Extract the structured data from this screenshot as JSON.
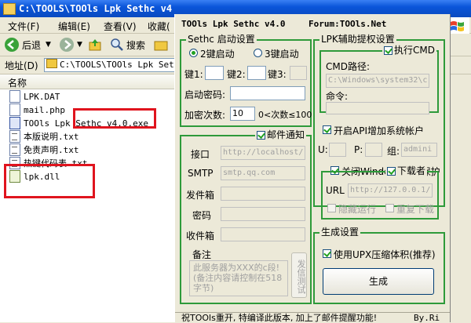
{
  "explorer": {
    "title": "C:\\TOOLS\\TOOls Lpk Sethc v4",
    "menu": [
      "文件(F)",
      "编辑(E)",
      "查看(V)",
      "收藏("
    ],
    "toolbar": {
      "back_label": "后退",
      "search_label": "搜索"
    },
    "address": {
      "label": "地址(D)",
      "value": "C:\\TOOLS\\TOOls Lpk Sethc"
    },
    "column_name": "名称",
    "files": [
      {
        "name": "LPK.DAT",
        "icon": "document-icon"
      },
      {
        "name": "mail.php",
        "icon": "document-icon"
      },
      {
        "name": "TOOls Lpk Sethc v4.0.exe",
        "icon": "exe-icon"
      },
      {
        "name": "本版说明.txt",
        "icon": "text-file-icon"
      },
      {
        "name": "免责声明.txt",
        "icon": "text-file-icon"
      },
      {
        "name": "热键代码表.txt",
        "icon": "text-file-icon"
      },
      {
        "name": "lpk.dll",
        "icon": "dll-icon"
      }
    ]
  },
  "tool": {
    "title": "TOOls Lpk Sethc v4.0",
    "forum": "Forum:TOOls.Net",
    "sethc": {
      "group_label": "Sethc 启动设置",
      "radio_2key": "2键启动",
      "radio_3key": "3键启动",
      "key1_label": "键1:",
      "key2_label": "键2:",
      "key3_label": "键3:",
      "key1_value": "",
      "key2_value": "",
      "key3_value": "",
      "password_label": "启动密码:",
      "password_value": "",
      "attempts_label": "加密次数:",
      "attempts_value": "10",
      "attempts_hint": "0<次数≤100"
    },
    "lpk": {
      "group_label": "LPK辅助提权设置",
      "exec_cmd_label": "执行CMD",
      "cmd_path_label": "CMD路径:",
      "cmd_path_value": "C:\\Windows\\system32\\c",
      "command_label": "命令:",
      "command_value": ""
    },
    "api_account": {
      "label": "开启API增加系统帐户",
      "u_label": "U:",
      "p_label": "P:",
      "group_label": "组:",
      "group_value": "admini"
    },
    "close_wfp_label": "关闭Windows文件保护",
    "mail": {
      "group_label": "邮件通知",
      "port_label": "接口",
      "port_value": "http://localhost/",
      "smtp_label": "SMTP",
      "smtp_value": "smtp.qq.com",
      "sender_label": "发件箱",
      "password_label": "密码",
      "receiver_label": "收件箱",
      "remark_label": "备注",
      "remark_value": "此服务器为XXX的c段!(备注内容请控制在518字节)",
      "test_button": "发信测试"
    },
    "downloader": {
      "group_label": "下载者",
      "url_label": "URL",
      "url_value": "http://127.0.0.1/",
      "hidden_run": "隐藏运行",
      "repeat_download": "重复下载"
    },
    "generate": {
      "group_label": "生成设置",
      "upx_label": "使用UPX压缩体积(推荐)",
      "button": "生成"
    },
    "status": {
      "message": "祝TOOls重开, 特编译此版本, 加上了邮件提醒功能!",
      "author": "By.Ri"
    }
  }
}
